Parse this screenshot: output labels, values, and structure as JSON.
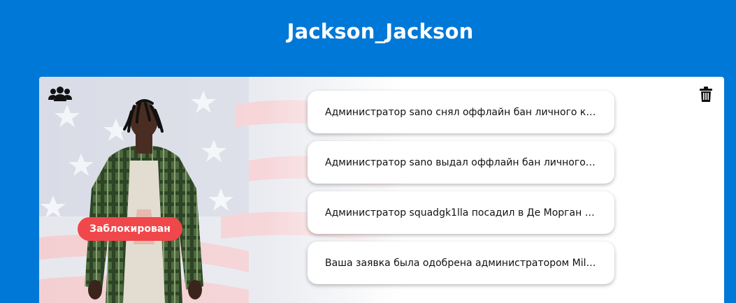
{
  "header": {
    "player_name": "Jackson_Jackson"
  },
  "profile": {
    "status": "Заблокирован",
    "status_color": "#f0474b",
    "icons": {
      "group": "users-group-icon",
      "delete": "trash-icon"
    },
    "background": "american-flag"
  },
  "notifications": [
    {
      "text": "Администратор sano снял оффлайн бан личного ка..."
    },
    {
      "text": "Администратор sano выдал оффлайн бан личного ..."
    },
    {
      "text": "Администратор squadgk1lla посадил в Де Морган н..."
    },
    {
      "text": "Ваша заявка была одобрена администратором Mill..."
    }
  ],
  "colors": {
    "page_bg": "#0078d7",
    "card_bg": "#ffffff"
  }
}
